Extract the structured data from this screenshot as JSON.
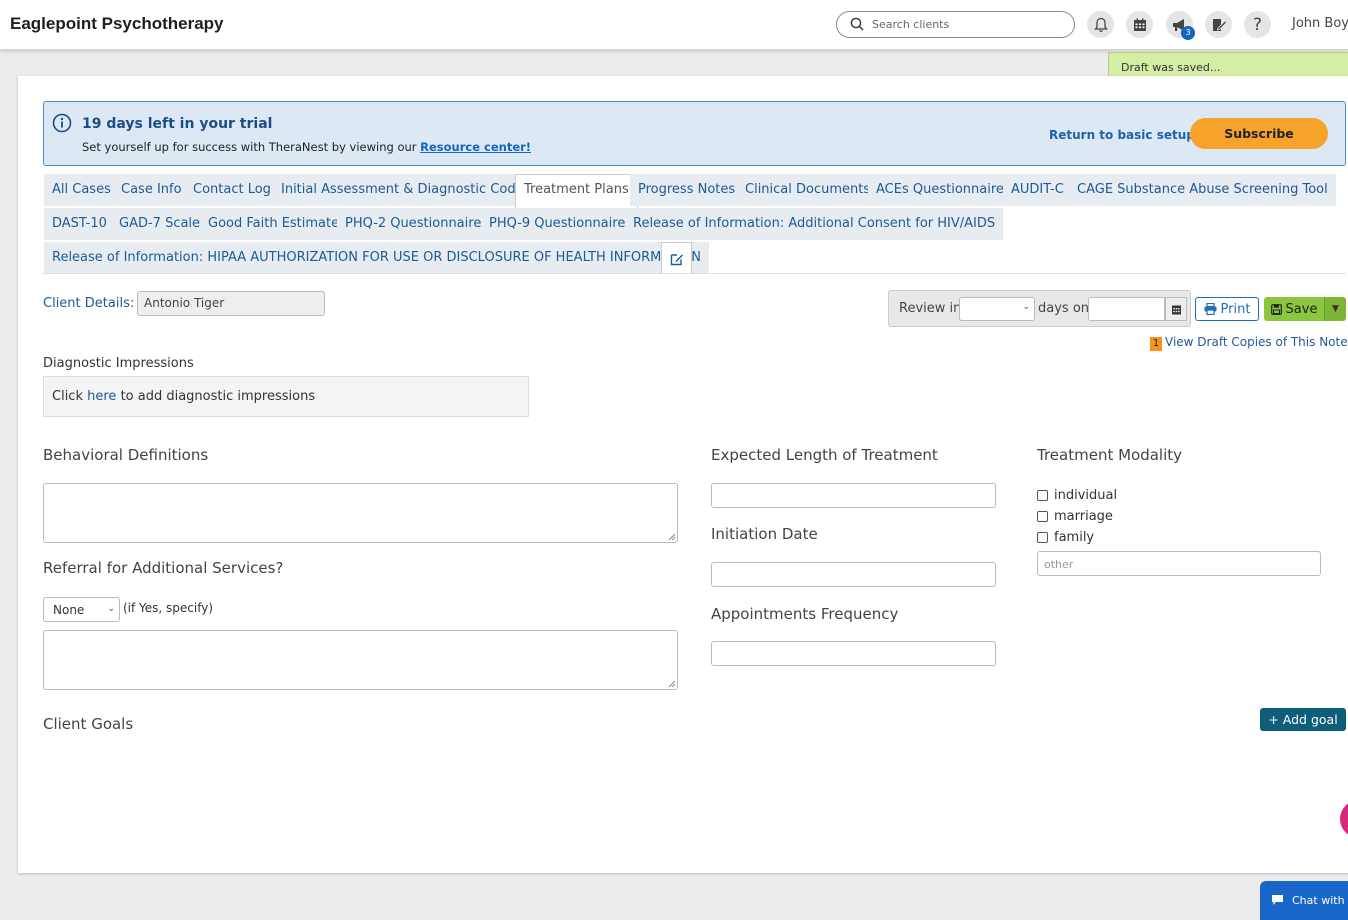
{
  "app": {
    "title": "Eaglepoint Psychotherapy",
    "user": "John Boy"
  },
  "search": {
    "placeholder": "Search clients"
  },
  "header": {
    "notification_count": "3"
  },
  "toast": {
    "message": "Draft was saved..."
  },
  "trial": {
    "title": "19 days left in your trial",
    "subtitle": "Set yourself up for success with TheraNest by viewing our",
    "link": "Resource center!",
    "return_label": "Return to basic setup",
    "subscribe_label": "Subscribe"
  },
  "tabs": [
    {
      "label": "All Cases"
    },
    {
      "label": "Case Info"
    },
    {
      "label": "Contact Log"
    },
    {
      "label": "Initial Assessment & Diagnostic Codes"
    },
    {
      "label": "Treatment Plans"
    },
    {
      "label": "Progress Notes"
    },
    {
      "label": "Clinical Documents"
    },
    {
      "label": "ACEs Questionnaire"
    },
    {
      "label": "AUDIT-C"
    },
    {
      "label": "CAGE Substance Abuse Screening Tool"
    },
    {
      "label": "DAST-10"
    },
    {
      "label": "GAD-7 Scale"
    },
    {
      "label": "Good Faith Estimate"
    },
    {
      "label": "PHQ-2 Questionnaire"
    },
    {
      "label": "PHQ-9 Questionnaire"
    },
    {
      "label": "Release of Information: Additional Consent for HIV/AIDS"
    },
    {
      "label": "Release of Information: HIPAA AUTHORIZATION FOR USE OR DISCLOSURE OF HEALTH INFORMATION"
    }
  ],
  "active_tab": "Treatment Plans",
  "client": {
    "label": "Client Details:",
    "name": "Antonio Tiger"
  },
  "review": {
    "prefix": "Review in",
    "middle": "days on",
    "days_value": "",
    "date_value": ""
  },
  "actions": {
    "print_label": "Print",
    "save_label": "Save"
  },
  "drafts": {
    "count": "1",
    "label": "View Draft Copies of This Note"
  },
  "diagnostic": {
    "heading": "Diagnostic Impressions",
    "pre": "Click",
    "link": "here",
    "post": "to add diagnostic impressions"
  },
  "behavioral": {
    "heading": "Behavioral Definitions",
    "value": ""
  },
  "referral": {
    "heading": "Referral for Additional Services?",
    "select_value": "None",
    "hint": "(if Yes, specify)",
    "value": ""
  },
  "expected_length": {
    "heading": "Expected Length of Treatment",
    "value": ""
  },
  "initiation_date": {
    "heading": "Initiation Date",
    "value": ""
  },
  "appointments_frequency": {
    "heading": "Appointments Frequency",
    "value": ""
  },
  "modality": {
    "heading": "Treatment Modality",
    "options": [
      {
        "label": "individual",
        "checked": false
      },
      {
        "label": "marriage",
        "checked": false
      },
      {
        "label": "family",
        "checked": false
      }
    ],
    "other_placeholder": "other"
  },
  "goals": {
    "heading": "Client Goals",
    "add_label": "+ Add goal"
  },
  "chat": {
    "label": "Chat with an expert"
  }
}
